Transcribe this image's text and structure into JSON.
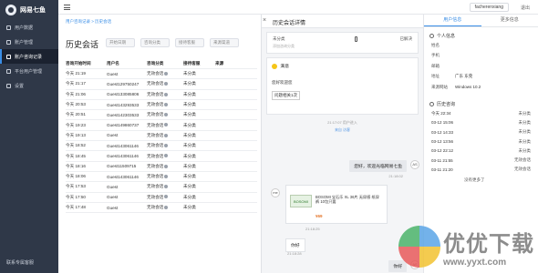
{
  "app": {
    "name": "网易七鱼"
  },
  "sidebar": {
    "items": [
      {
        "label": "用户数据"
      },
      {
        "label": "账户管理"
      },
      {
        "label": "账户咨询记录"
      },
      {
        "label": "平台用户管理"
      },
      {
        "label": "设置"
      }
    ],
    "footer": "联系专属客服"
  },
  "topbar": {
    "user": "facherenxiang",
    "logout": "退出"
  },
  "breadcrumb": "用户咨询记录 > 历史会话",
  "page_title": "历史会话",
  "filters": [
    "开始日期",
    "咨询分类",
    "接待客服",
    "来源渠道"
  ],
  "table": {
    "headers": [
      "咨询开始时间",
      "用户名",
      "咨询分类",
      "接待客服",
      "来源"
    ],
    "rows": [
      [
        "今天 21:19",
        "Guest",
        "无效会话",
        "未分类",
        ""
      ],
      [
        "今天 21:17",
        "Guest129750247",
        "无效会话",
        "未分类",
        ""
      ],
      [
        "今天 21:06",
        "Guest133085806",
        "无效会话",
        "未分类",
        ""
      ],
      [
        "今天 20:53",
        "Guest143293533",
        "无效会话",
        "未分类",
        ""
      ],
      [
        "今天 20:51",
        "Guest142303533",
        "无效会话",
        "未分类",
        ""
      ],
      [
        "今天 19:23",
        "Guest149860737",
        "无效会话",
        "未分类",
        ""
      ],
      [
        "今天 19:13",
        "Guest",
        "无效会话",
        "未分类",
        ""
      ],
      [
        "今天 18:52",
        "Guest143061146",
        "无效会话",
        "未分类",
        ""
      ],
      [
        "今天 18:45",
        "Guest143061146",
        "无效会话",
        "未分类",
        ""
      ],
      [
        "今天 18:16",
        "Guest11509715",
        "无效会话",
        "未分类",
        ""
      ],
      [
        "今天 18:06",
        "Guest143061146",
        "无效会话",
        "未分类",
        ""
      ],
      [
        "今天 17:53",
        "Guest",
        "无效会话",
        "未分类",
        ""
      ],
      [
        "今天 17:50",
        "Guest",
        "无效会话",
        "未分类",
        ""
      ],
      [
        "今天 17:48",
        "Guest",
        "无效会话",
        "未分类",
        ""
      ]
    ]
  },
  "chat": {
    "close": "×",
    "title": "历史会话详情",
    "visitor_label": "未分类",
    "visitor_sub": "添加咨询分类",
    "status": "已解决",
    "faq_question": "满意",
    "faq_intro": "您好欢迎您",
    "faq_tag": "问题相关1次",
    "sys1": "21:17:07 用户进入",
    "sys2": "来自 访客",
    "msg_greeting": "您好，欢迎光临网易七鱼",
    "msg_greeting_time": "21:18:02",
    "product_desc": "BOSOMI 宝石乐 XL 36片 无尿感 纸尿裤 10包只要",
    "product_price": "¥69",
    "product_thumb_text": "BOSOMI",
    "product_time": "21:18:25",
    "msg_hello_left": "你好",
    "msg_hello_left_time": "21:18:28",
    "msg_hello_right": "你好",
    "avatar_right": "AS",
    "avatar_left": "me"
  },
  "info": {
    "tabs": [
      "用户信息",
      "更多信息"
    ],
    "personal_title": "个人信息",
    "fields": [
      {
        "k": "姓名",
        "v": ""
      },
      {
        "k": "手机",
        "v": ""
      },
      {
        "k": "邮箱",
        "v": ""
      },
      {
        "k": "地址",
        "v": "广东 东莞"
      },
      {
        "k": "来源网站",
        "v": "Windows 10.2"
      }
    ],
    "history_title": "历史咨询",
    "history": [
      {
        "time": "今天 22:34",
        "tag": "未分类"
      },
      {
        "time": "03-12 15:06",
        "tag": "未分类"
      },
      {
        "time": "03-12 14:33",
        "tag": "未分类"
      },
      {
        "time": "03-12 13:56",
        "tag": "未分类"
      },
      {
        "time": "03-12 22:12",
        "tag": "未分类"
      },
      {
        "time": "03-11 21:55",
        "tag": "无效会话"
      },
      {
        "time": "03-11 21:20",
        "tag": "无效会话"
      }
    ],
    "more": "没有更多了"
  },
  "watermark": {
    "cn": "优优下载",
    "url": "www.yyxt.com"
  },
  "colors": {
    "sidebar": "#2f3848",
    "accent": "#3a8ee6"
  }
}
